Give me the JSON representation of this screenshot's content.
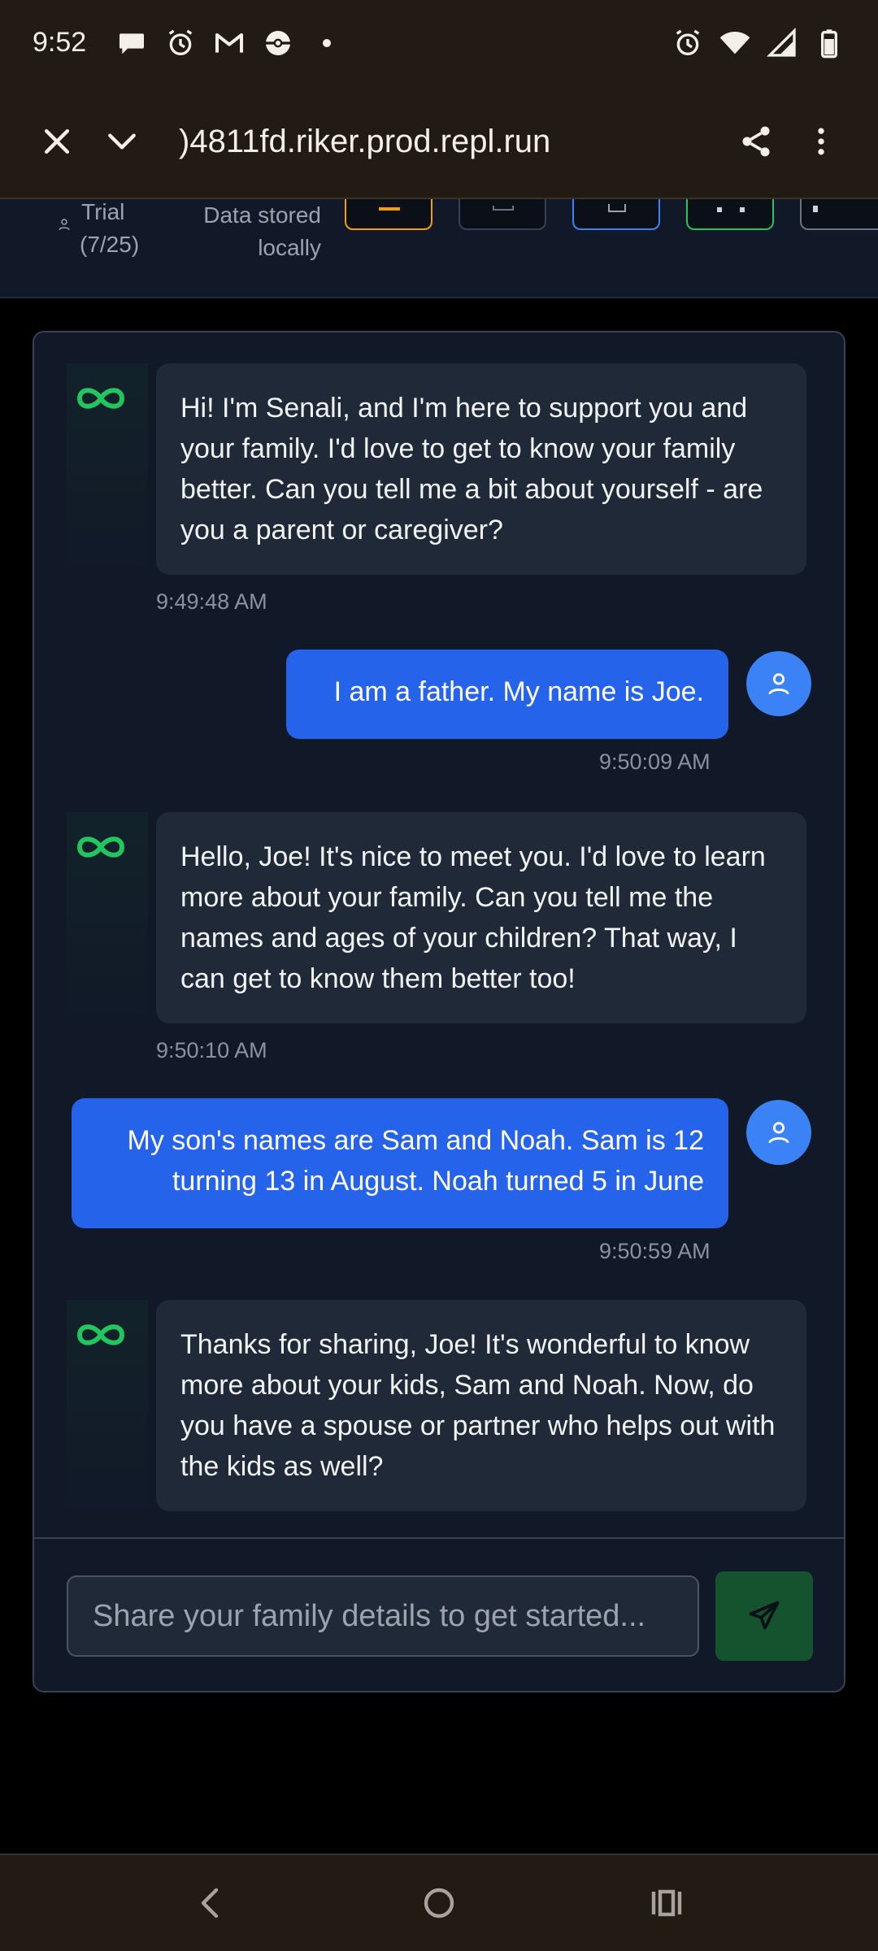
{
  "status_bar": {
    "time": "9:52",
    "left_icons": [
      "chat-bubble-icon",
      "alarm-icon",
      "gmail-icon",
      "pokeball-icon",
      "dot-icon"
    ],
    "right_icons": [
      "alarm-icon",
      "wifi-icon",
      "signal-icon",
      "battery-icon"
    ]
  },
  "browser": {
    "url": ")4811fd.riker.prod.repl.run"
  },
  "header": {
    "trial_line1": "Trial",
    "trial_line2": "(7/25)",
    "data_stored_line1": "Data stored",
    "data_stored_line2": "locally",
    "chip_colors": [
      "#f59e0b",
      "#374151",
      "#3b82f6",
      "#22c55e",
      "#6b7280"
    ]
  },
  "chat": {
    "messages": [
      {
        "role": "bot",
        "text": "Hi! I'm Senali, and I'm here to support you and your family. I'd love to get to know your family better. Can you tell me a bit about yourself - are you a parent or caregiver?",
        "time": "9:49:48 AM"
      },
      {
        "role": "user",
        "text": "I am a father.  My name is Joe.",
        "time": "9:50:09 AM"
      },
      {
        "role": "bot",
        "text": "Hello, Joe! It's nice to meet you. I'd love to learn more about your family. Can you tell me the names and ages of your children? That way, I can get to know them better too!",
        "time": "9:50:10 AM"
      },
      {
        "role": "user",
        "text": "My son's names are Sam and Noah.  Sam is 12 turning 13 in August.  Noah turned 5 in June",
        "time": "9:50:59 AM"
      },
      {
        "role": "bot",
        "text": "Thanks for sharing, Joe! It's wonderful to know more about your kids, Sam and Noah. Now, do you have a spouse or partner who helps out with the kids as well?",
        "time": ""
      }
    ],
    "input_placeholder": "Share your family details to get started...",
    "input_value": ""
  },
  "colors": {
    "accent_green": "#22c55e",
    "user_bubble": "#2563eb",
    "bot_bubble": "#1f2937",
    "send_button": "#14532d"
  }
}
